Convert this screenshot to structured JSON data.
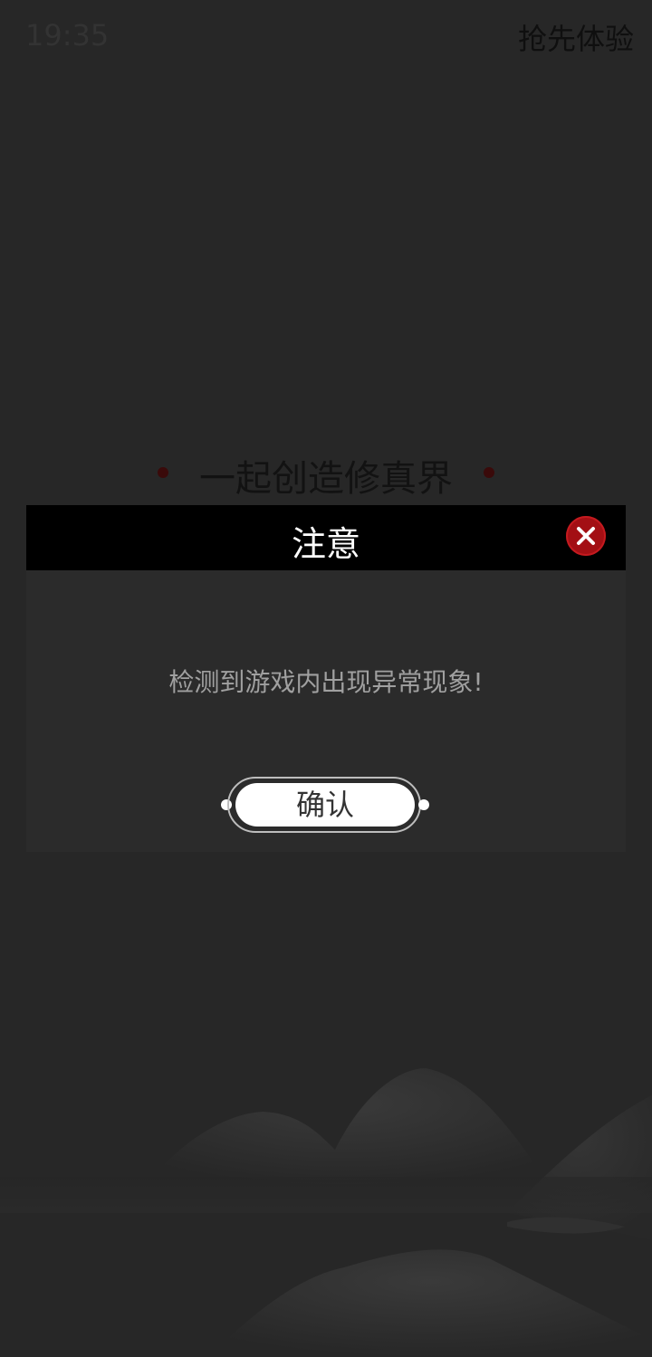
{
  "status_bar": {
    "time": "19:35"
  },
  "header": {
    "action_label": "抢先体验"
  },
  "slogan": {
    "text": "一起创造修真界"
  },
  "dialog": {
    "title": "注意",
    "message": "检测到游戏内出现异常现象!",
    "confirm_label": "确认",
    "close_icon": "close-icon"
  },
  "colors": {
    "background": "#272727",
    "dialog_header": "#000000",
    "close_button": "#a30f14",
    "slogan_dot": "#3a0a0a"
  }
}
